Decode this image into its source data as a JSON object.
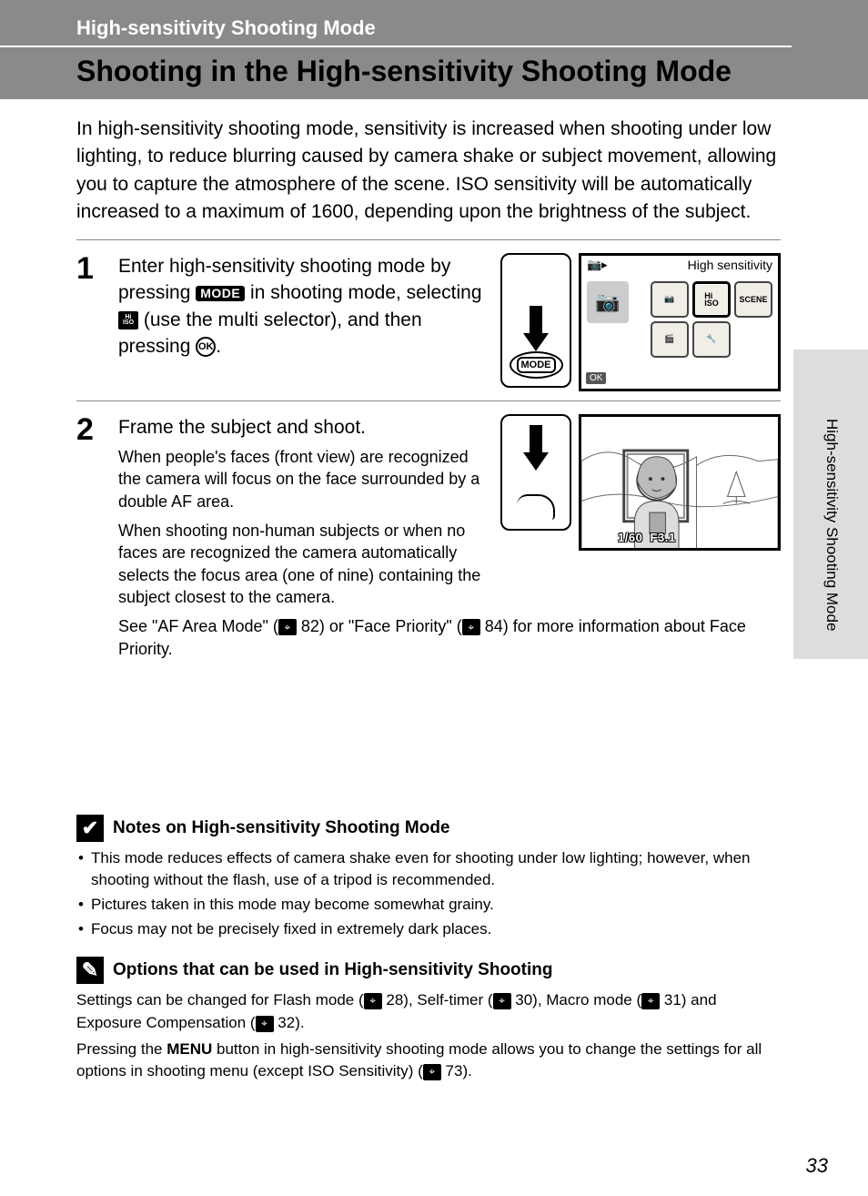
{
  "header": {
    "section_label": "High-sensitivity Shooting Mode",
    "page_title": "Shooting in the High-sensitivity Shooting Mode"
  },
  "intro": "In high-sensitivity shooting mode, sensitivity is increased when shooting under low lighting, to reduce blurring caused by camera shake or subject movement, allowing you to capture the atmosphere of the scene. ISO sensitivity will be automatically increased to a maximum of 1600, depending upon the brightness of the subject.",
  "steps": {
    "step1": {
      "num": "1",
      "text_pre": "Enter high-sensitivity shooting mode by pressing ",
      "mode_label": "MODE",
      "text_mid1": " in shooting mode, selecting ",
      "iso_label_top": "Hi",
      "iso_label_bot": "ISO",
      "text_mid2": " (use the multi selector), and then pressing ",
      "ok_label": "OK",
      "text_post": ".",
      "lcd": {
        "title": "High sensitivity",
        "ok_badge": "OK",
        "cells": {
          "cam": "◯",
          "iso_top": "Hi",
          "iso_bot": "ISO",
          "scene": "SCENE",
          "movie": "🎬",
          "setup": "🔧"
        }
      },
      "mode_btn_label": "MODE"
    },
    "step2": {
      "num": "2",
      "head": "Frame the subject and shoot.",
      "p1": "When people's faces (front view) are recognized the camera will focus on the face surrounded by a double AF area.",
      "p2": "When shooting non-human subjects or when no faces are recognized the camera automatically selects the focus area (one of nine) containing the subject closest to the camera.",
      "p3_pre": "See \"AF Area Mode\" (",
      "p3_ref1": " 82",
      "p3_mid": ") or \"Face Priority\" (",
      "p3_ref2": " 84",
      "p3_post": ") for more information about Face Priority.",
      "overlay_shutter": "1/60",
      "overlay_fstop": "F3.1"
    }
  },
  "notes": {
    "title": "Notes on High-sensitivity Shooting Mode",
    "items": [
      "This mode reduces effects of camera shake even for shooting under low lighting; however, when shooting without the flash, use of a tripod is recommended.",
      "Pictures taken in this mode may become somewhat grainy.",
      "Focus may not be precisely fixed in extremely dark places."
    ]
  },
  "options": {
    "title": "Options that can be used in High-sensitivity Shooting",
    "p1_pre": "Settings can be changed for Flash mode (",
    "p1_r1": " 28",
    "p1_m1": "), Self-timer (",
    "p1_r2": " 30",
    "p1_m2": "), Macro mode (",
    "p1_r3": " 31",
    "p1_m3": ") and Exposure Compensation (",
    "p1_r4": " 32",
    "p1_post": ").",
    "p2_pre": "Pressing the ",
    "p2_menu": "MENU",
    "p2_mid": " button in high-sensitivity shooting mode allows you to change the settings for all options in shooting menu (except ISO Sensitivity) (",
    "p2_r1": " 73",
    "p2_post": ")."
  },
  "side_label": "High-sensitivity Shooting Mode",
  "page_number": "33"
}
